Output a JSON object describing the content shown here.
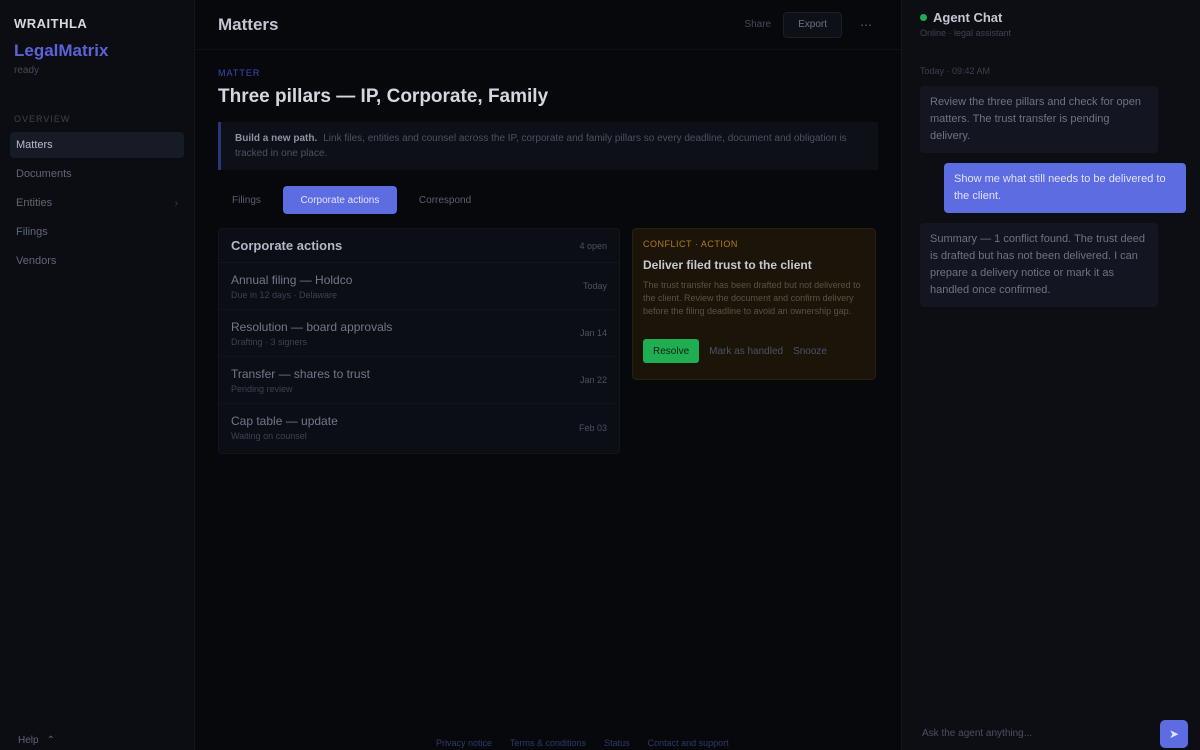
{
  "sidebar": {
    "brand_small": "WRAITHLA",
    "brand_big": "LegalMatrix",
    "brand_sub": "ready",
    "section": "OVERVIEW",
    "items": [
      {
        "label": "Matters",
        "active": true
      },
      {
        "label": "Documents",
        "active": false
      },
      {
        "label": "Entities",
        "active": false
      },
      {
        "label": "Filings",
        "active": false
      },
      {
        "label": "Vendors",
        "active": false
      }
    ],
    "footer": "Help"
  },
  "topbar": {
    "title": "Matters",
    "link": "Share",
    "button": "Export",
    "icon": "more-icon"
  },
  "main": {
    "crumb": "MATTER",
    "title": "Three pillars — IP, Corporate, Family",
    "callout_label": "Build a new path.",
    "callout_text": "Link files, entities and counsel across the IP, corporate and family pillars so every deadline, document and obligation is tracked in one place.",
    "tabs": [
      "Filings",
      "Corporate actions",
      "Correspond"
    ],
    "active_tab": 1,
    "list": {
      "title": "Corporate actions",
      "count": "4 open",
      "rows": [
        {
          "title": "Annual filing — Holdco",
          "sub": "Due in 12 days · Delaware",
          "meta": "Today"
        },
        {
          "title": "Resolution — board approvals",
          "sub": "Drafting · 3 signers",
          "meta": "Jan 14"
        },
        {
          "title": "Transfer — shares to trust",
          "sub": "Pending review",
          "meta": "Jan 22"
        },
        {
          "title": "Cap table — update",
          "sub": "Waiting on counsel",
          "meta": "Feb 03"
        }
      ]
    },
    "warning": {
      "label": "CONFLICT · ACTION",
      "title": "Deliver filed trust to the client",
      "body": "The trust transfer has been drafted but not delivered to the client. Review the document and confirm delivery before the filing deadline to avoid an ownership gap.",
      "primary": "Resolve",
      "secondary": "Mark as handled",
      "tertiary": "Snooze"
    },
    "footer_links": [
      "Privacy notice",
      "Terms & conditions",
      "Status",
      "Contact and support"
    ]
  },
  "chat": {
    "title": "Agent Chat",
    "status_color": "#1fae52",
    "subtitle": "Online · legal assistant",
    "day": "Today · 09:42 AM",
    "messages": [
      {
        "role": "ai",
        "text": "Review the three pillars and check for open matters. The trust transfer is pending delivery."
      },
      {
        "role": "user",
        "text": "Show me what still needs to be delivered to the client."
      },
      {
        "role": "ai",
        "text": "Summary — 1 conflict found. The trust deed is drafted but has not been delivered. I can prepare a delivery notice or mark it as handled once confirmed."
      }
    ],
    "input_placeholder": "Ask the agent anything...",
    "send_icon": "send-icon"
  },
  "colors": {
    "accent": "#5e6ce2",
    "success": "#1fae52",
    "warning": "#b07a1c"
  }
}
